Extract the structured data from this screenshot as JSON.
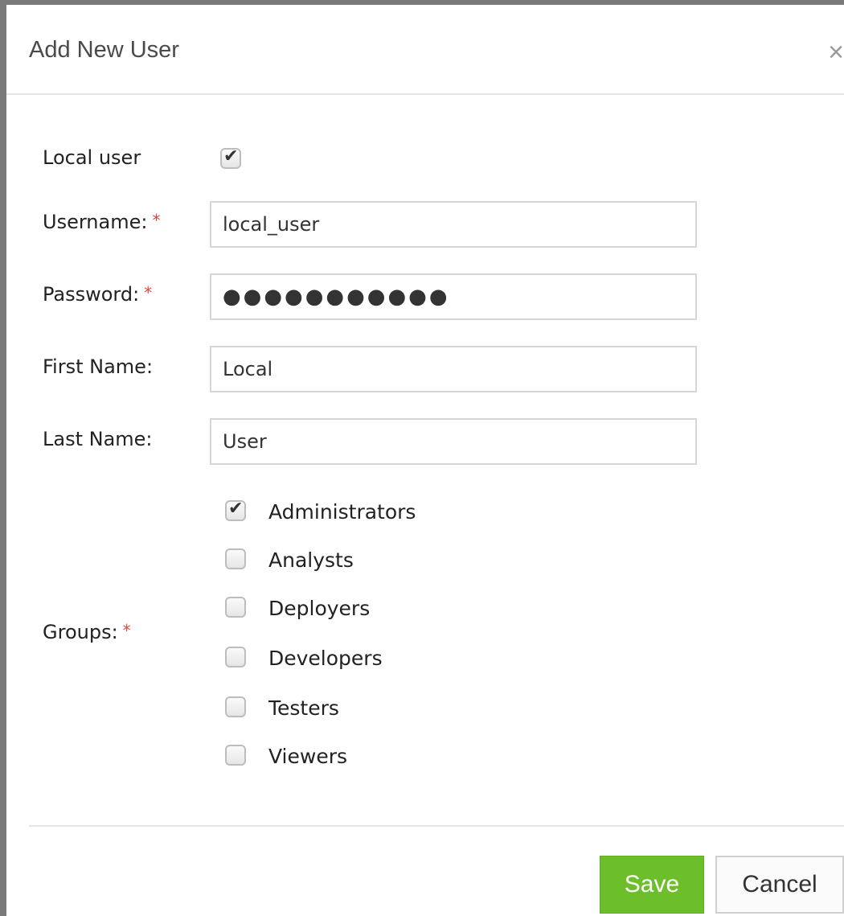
{
  "dialog": {
    "title": "Add New User",
    "close_glyph": "×"
  },
  "form": {
    "local_user": {
      "label": "Local user",
      "checked": true
    },
    "username": {
      "label": "Username:",
      "value": "local_user",
      "required_mark": "*"
    },
    "password": {
      "label": "Password:",
      "value": "●●●●●●●●●●●",
      "required_mark": "*"
    },
    "first_name": {
      "label": "First Name:",
      "value": "Local"
    },
    "last_name": {
      "label": "Last Name:",
      "value": "User"
    },
    "groups": {
      "label": "Groups:",
      "required_mark": "*",
      "items": [
        {
          "label": "Administrators",
          "checked": true
        },
        {
          "label": "Analysts",
          "checked": false
        },
        {
          "label": "Deployers",
          "checked": false
        },
        {
          "label": "Developers",
          "checked": false
        },
        {
          "label": "Testers",
          "checked": false
        },
        {
          "label": "Viewers",
          "checked": false
        }
      ]
    }
  },
  "footer": {
    "save_label": "Save",
    "cancel_label": "Cancel"
  },
  "colors": {
    "save_button": "#6cbf2b",
    "required_mark": "#e8433a"
  },
  "icons": {
    "check": "check-icon",
    "close": "close-icon"
  }
}
